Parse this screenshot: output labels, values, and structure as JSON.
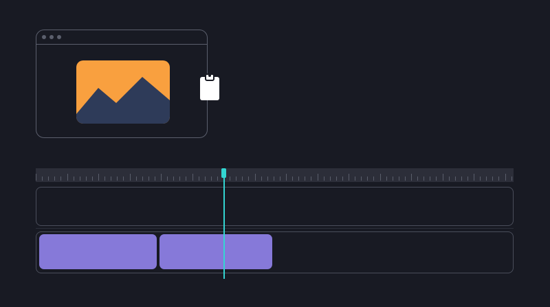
{
  "editor": {
    "preview_window": {
      "controls": [
        "dot",
        "dot",
        "dot"
      ],
      "image_icon": "landscape-image-icon",
      "paste_icon": "clipboard-icon"
    },
    "timeline": {
      "clips": [
        {
          "track": "track-2",
          "color": "#8679d9"
        },
        {
          "track": "track-2",
          "color": "#8679d9"
        }
      ],
      "playhead_color": "#33d6d2"
    },
    "colors": {
      "background": "#181a23",
      "thumbnail_sky": "#f9a03f",
      "thumbnail_mountain": "#2e3b59",
      "clip": "#8679d9",
      "playhead": "#33d6d2"
    }
  }
}
